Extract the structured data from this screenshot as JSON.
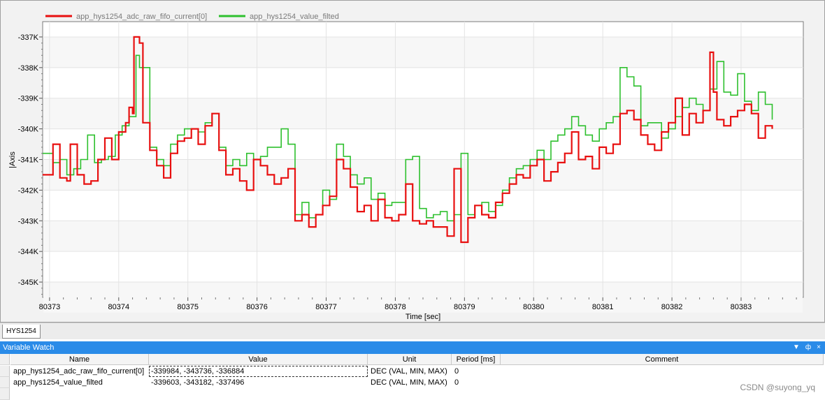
{
  "chart": {
    "legend": [
      {
        "name": "app_hys1254_adc_raw_fifo_current[0]",
        "color": "#e81010"
      },
      {
        "name": "app_hys1254_value_filted",
        "color": "#2ec02e"
      }
    ]
  },
  "chart_data": {
    "type": "line",
    "title": "",
    "xlabel": "Time [sec]",
    "ylabel": "|Axis",
    "xlim": [
      80372.9,
      80383.9
    ],
    "ylim": [
      -345.5,
      -336.5
    ],
    "x_ticks": [
      "80373",
      "80374",
      "80375",
      "80376",
      "80377",
      "80378",
      "80379",
      "80380",
      "80381",
      "80382",
      "80383"
    ],
    "y_ticks": [
      "-337K",
      "-338K",
      "-339K",
      "-340K",
      "-341K",
      "-342K",
      "-343K",
      "-344K",
      "-345K"
    ],
    "grid": true,
    "legend_position": "top-left",
    "y_units": "K",
    "series": [
      {
        "name": "app_hys1254_adc_raw_fifo_current[0]",
        "color": "#e81010",
        "x": [
          80372.9,
          80373.05,
          80373.15,
          80373.25,
          80373.3,
          80373.4,
          80373.5,
          80373.6,
          80373.7,
          80373.8,
          80373.9,
          80374.0,
          80374.1,
          80374.15,
          80374.2,
          80374.22,
          80374.3,
          80374.35,
          80374.45,
          80374.55,
          80374.65,
          80374.75,
          80374.85,
          80374.95,
          80375.05,
          80375.15,
          80375.25,
          80375.35,
          80375.45,
          80375.55,
          80375.65,
          80375.75,
          80375.85,
          80375.95,
          80376.05,
          80376.15,
          80376.25,
          80376.35,
          80376.45,
          80376.55,
          80376.65,
          80376.75,
          80376.85,
          80376.95,
          80377.05,
          80377.15,
          80377.25,
          80377.35,
          80377.45,
          80377.55,
          80377.65,
          80377.75,
          80377.85,
          80377.95,
          80378.05,
          80378.15,
          80378.25,
          80378.35,
          80378.45,
          80378.55,
          80378.65,
          80378.75,
          80378.85,
          80378.95,
          80379.05,
          80379.15,
          80379.25,
          80379.35,
          80379.45,
          80379.55,
          80379.65,
          80379.75,
          80379.85,
          80379.95,
          80380.05,
          80380.15,
          80380.25,
          80380.35,
          80380.45,
          80380.55,
          80380.65,
          80380.75,
          80380.85,
          80380.95,
          80381.05,
          80381.15,
          80381.25,
          80381.35,
          80381.45,
          80381.55,
          80381.65,
          80381.75,
          80381.85,
          80381.95,
          80382.05,
          80382.15,
          80382.25,
          80382.35,
          80382.45,
          80382.55,
          80382.6,
          80382.65,
          80382.75,
          80382.85,
          80382.95,
          80383.05,
          80383.15,
          80383.25,
          80383.35,
          80383.45
        ],
        "values": [
          -341.5,
          -340.5,
          -341.6,
          -341.7,
          -340.5,
          -341.5,
          -341.8,
          -341.7,
          -341.0,
          -340.3,
          -341.0,
          -340.1,
          -339.8,
          -339.3,
          -339.5,
          -337.0,
          -337.2,
          -339.8,
          -340.7,
          -341.2,
          -341.6,
          -340.8,
          -340.4,
          -340.3,
          -340.0,
          -340.5,
          -339.9,
          -339.5,
          -340.7,
          -341.5,
          -341.3,
          -341.7,
          -342.0,
          -341.0,
          -341.2,
          -341.5,
          -341.8,
          -341.6,
          -341.3,
          -343.0,
          -342.8,
          -343.2,
          -342.8,
          -342.5,
          -342.2,
          -341.0,
          -341.3,
          -341.9,
          -342.7,
          -342.5,
          -343.0,
          -342.3,
          -342.9,
          -343.0,
          -342.8,
          -341.8,
          -343.0,
          -343.1,
          -343.0,
          -343.2,
          -343.2,
          -343.5,
          -341.3,
          -343.7,
          -342.9,
          -342.5,
          -342.8,
          -342.9,
          -342.4,
          -342.1,
          -341.8,
          -341.5,
          -341.6,
          -341.2,
          -341.0,
          -341.7,
          -341.4,
          -341.1,
          -340.8,
          -340.1,
          -341.0,
          -340.9,
          -341.3,
          -340.6,
          -340.8,
          -340.5,
          -339.5,
          -339.4,
          -339.7,
          -340.2,
          -340.5,
          -340.7,
          -340.1,
          -339.8,
          -339.0,
          -340.2,
          -339.5,
          -339.8,
          -339.4,
          -337.5,
          -338.8,
          -339.7,
          -339.9,
          -339.6,
          -339.4,
          -339.2,
          -339.5,
          -340.3,
          -339.9,
          -340.0
        ]
      },
      {
        "name": "app_hys1254_value_filted",
        "color": "#2ec02e",
        "x": [
          80372.9,
          80373.05,
          80373.15,
          80373.25,
          80373.35,
          80373.45,
          80373.55,
          80373.65,
          80373.75,
          80373.85,
          80373.95,
          80374.05,
          80374.15,
          80374.25,
          80374.3,
          80374.35,
          80374.45,
          80374.55,
          80374.65,
          80374.75,
          80374.85,
          80374.95,
          80375.05,
          80375.15,
          80375.25,
          80375.35,
          80375.45,
          80375.55,
          80375.65,
          80375.75,
          80375.85,
          80375.95,
          80376.05,
          80376.15,
          80376.25,
          80376.35,
          80376.45,
          80376.55,
          80376.65,
          80376.75,
          80376.85,
          80376.95,
          80377.05,
          80377.15,
          80377.25,
          80377.35,
          80377.45,
          80377.55,
          80377.65,
          80377.75,
          80377.85,
          80377.95,
          80378.05,
          80378.15,
          80378.25,
          80378.35,
          80378.45,
          80378.55,
          80378.65,
          80378.75,
          80378.85,
          80378.95,
          80379.05,
          80379.15,
          80379.25,
          80379.35,
          80379.45,
          80379.55,
          80379.65,
          80379.75,
          80379.85,
          80379.95,
          80380.05,
          80380.15,
          80380.25,
          80380.35,
          80380.45,
          80380.55,
          80380.65,
          80380.75,
          80380.85,
          80380.95,
          80381.05,
          80381.15,
          80381.25,
          80381.35,
          80381.45,
          80381.55,
          80381.65,
          80381.75,
          80381.85,
          80381.95,
          80382.05,
          80382.15,
          80382.25,
          80382.35,
          80382.45,
          80382.55,
          80382.65,
          80382.75,
          80382.85,
          80382.95,
          80383.05,
          80383.15,
          80383.25,
          80383.35,
          80383.45
        ],
        "values": [
          -340.8,
          -341.1,
          -341.0,
          -341.5,
          -341.3,
          -341.0,
          -340.2,
          -341.1,
          -341.0,
          -340.9,
          -340.2,
          -339.9,
          -339.6,
          -337.6,
          -338.0,
          -338.0,
          -340.6,
          -341.0,
          -341.2,
          -340.5,
          -340.2,
          -340.0,
          -340.0,
          -340.1,
          -339.8,
          -339.5,
          -340.6,
          -341.2,
          -341.0,
          -341.2,
          -340.8,
          -341.0,
          -340.9,
          -340.6,
          -340.6,
          -340.0,
          -340.5,
          -342.8,
          -342.4,
          -342.9,
          -342.8,
          -342.0,
          -342.3,
          -340.5,
          -340.9,
          -341.5,
          -341.8,
          -341.6,
          -342.3,
          -342.1,
          -342.5,
          -342.4,
          -342.4,
          -341.0,
          -340.9,
          -342.6,
          -342.9,
          -342.8,
          -342.7,
          -343.0,
          -342.8,
          -340.8,
          -342.8,
          -342.5,
          -342.4,
          -342.7,
          -342.5,
          -342.0,
          -341.6,
          -341.3,
          -341.2,
          -341.0,
          -340.7,
          -341.0,
          -340.4,
          -340.2,
          -340.0,
          -339.6,
          -339.9,
          -340.2,
          -340.4,
          -340.0,
          -339.8,
          -339.6,
          -338.0,
          -338.3,
          -338.6,
          -339.9,
          -339.8,
          -339.8,
          -340.3,
          -340.0,
          -339.6,
          -339.3,
          -339.0,
          -339.2,
          -339.4,
          -338.7,
          -337.8,
          -338.8,
          -338.9,
          -338.2,
          -339.1,
          -339.4,
          -338.8,
          -339.2,
          -339.7
        ]
      }
    ]
  },
  "tabs": [
    {
      "label": "HYS1254"
    }
  ],
  "variable_watch": {
    "title": "Variable Watch",
    "controls": [
      "▼",
      "ф",
      "×"
    ],
    "columns": [
      "Name",
      "Value",
      "Unit",
      "Period [ms]",
      "Comment"
    ],
    "rows": [
      {
        "name": "app_hys1254_adc_raw_fifo_current[0]",
        "value": "-339984, -343736, -336884",
        "unit": "DEC (VAL, MIN, MAX)",
        "period": "0",
        "comment": ""
      },
      {
        "name": "app_hys1254_value_filted",
        "value": "-339603, -343182, -337496",
        "unit": "DEC (VAL, MIN, MAX)",
        "period": "0",
        "comment": ""
      }
    ]
  },
  "watermark": "CSDN @suyong_yq"
}
